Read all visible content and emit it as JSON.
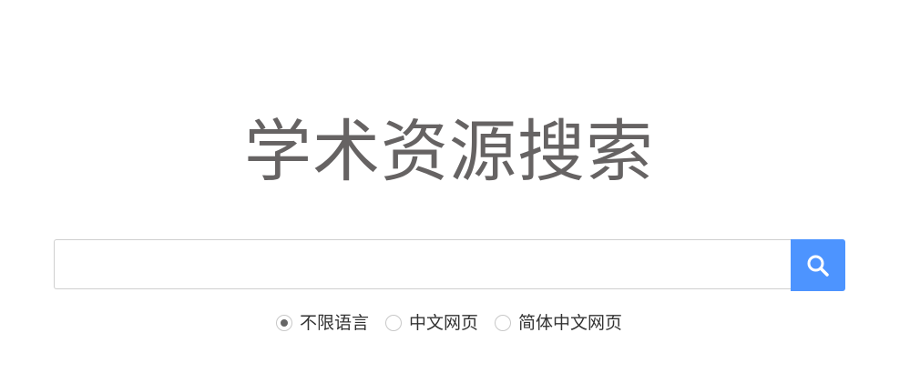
{
  "page": {
    "title": "学术资源搜索"
  },
  "search": {
    "value": "",
    "placeholder": "",
    "button_icon": "search-icon",
    "button_color": "#4d94ff"
  },
  "language_options": [
    {
      "label": "不限语言",
      "checked": true
    },
    {
      "label": "中文网页",
      "checked": false
    },
    {
      "label": "简体中文网页",
      "checked": false
    }
  ]
}
